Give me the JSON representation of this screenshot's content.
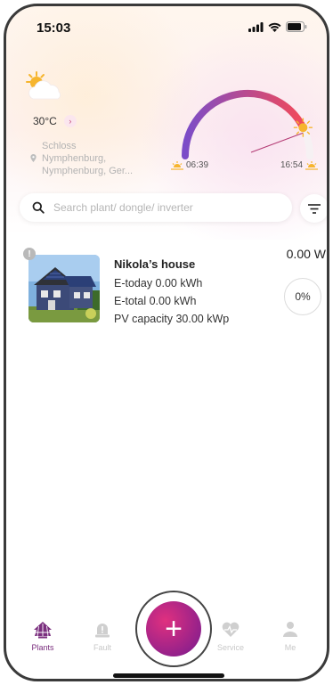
{
  "status_bar": {
    "time": "15:03"
  },
  "weather": {
    "temperature": "30°C",
    "location_lines": [
      "Schloss",
      "Nymphenburg,",
      "Nymphenburg, Ger..."
    ],
    "sunrise": "06:39",
    "sunset": "16:54",
    "sun_arc_progress": 0.85
  },
  "search": {
    "placeholder": "Search plant/ dongle/ inverter",
    "value": ""
  },
  "plant_card": {
    "name": "Nikola’s house",
    "e_today": "E-today 0.00 kWh",
    "e_total": "E-total 0.00 kWh",
    "pv_capacity": "PV capacity 30.00 kWp",
    "power": "0.00 W",
    "percent": "0%",
    "alert_symbol": "!"
  },
  "tabs": [
    {
      "label": "Plants",
      "icon": "plants-icon",
      "active": true
    },
    {
      "label": "Fault",
      "icon": "fault-icon",
      "active": false
    },
    {
      "label": "Service",
      "icon": "service-icon",
      "active": false
    },
    {
      "label": "Me",
      "icon": "me-icon",
      "active": false
    }
  ],
  "fab": {
    "symbol": "+"
  },
  "colors": {
    "accent": "#7a2e7e",
    "fab_start": "#e0307f",
    "fab_end": "#8a1f8c",
    "arc_start": "#7b4cc8",
    "arc_end": "#f24a5a"
  }
}
